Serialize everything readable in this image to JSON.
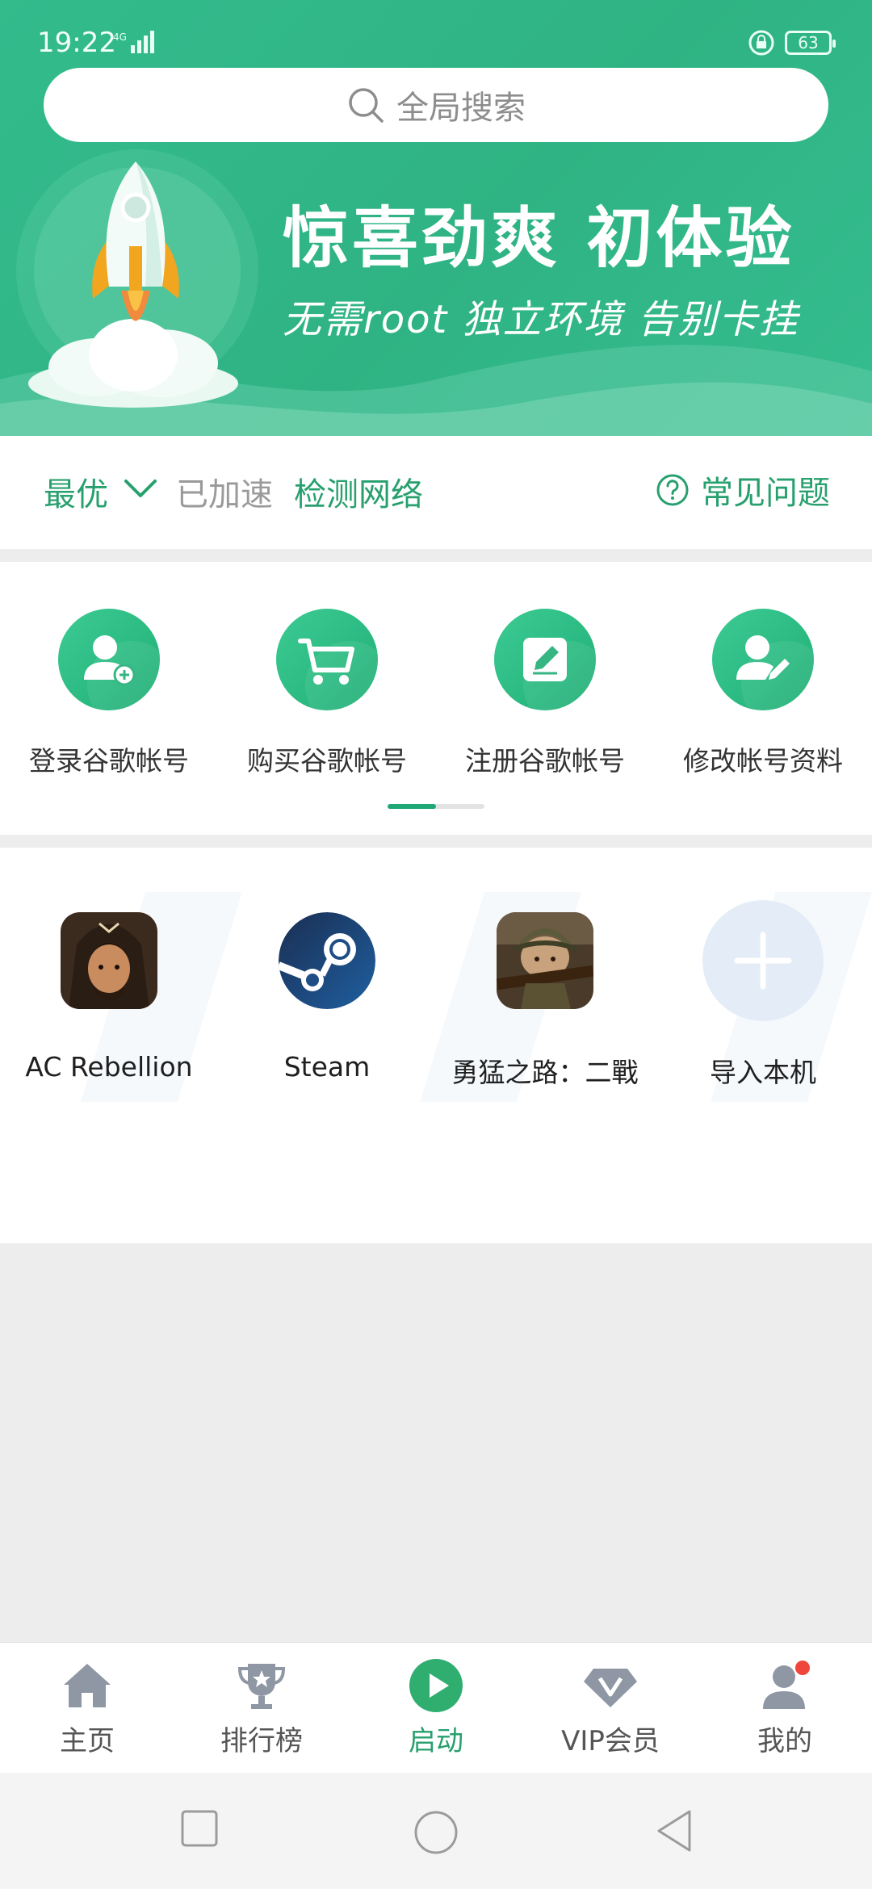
{
  "status_bar": {
    "time": "19:22",
    "network": "4G",
    "battery": "63"
  },
  "search": {
    "placeholder": "全局搜索"
  },
  "banner": {
    "title": "惊喜劲爽  初体验",
    "subtitle": "无需root  独立环境  告别卡挂"
  },
  "network_bar": {
    "mode": "最优",
    "status": "已加速",
    "check_label": "检测网络",
    "faq_label": "常见问题"
  },
  "actions": [
    {
      "label": "登录谷歌帐号",
      "icon": "user-add-icon"
    },
    {
      "label": "购买谷歌帐号",
      "icon": "cart-icon"
    },
    {
      "label": "注册谷歌帐号",
      "icon": "edit-note-icon"
    },
    {
      "label": "修改帐号资料",
      "icon": "user-edit-icon"
    }
  ],
  "pager": {
    "current": 1,
    "total": 2
  },
  "apps": [
    {
      "label": "AC Rebellion",
      "icon": "ac-rebellion-icon"
    },
    {
      "label": "Steam",
      "icon": "steam-icon"
    },
    {
      "label": "勇猛之路：二戰",
      "icon": "soldier-game-icon"
    },
    {
      "label": "导入本机",
      "icon": "plus-icon"
    }
  ],
  "bottom_nav": [
    {
      "label": "主页",
      "icon": "home-icon",
      "active": false
    },
    {
      "label": "排行榜",
      "icon": "trophy-icon",
      "active": false
    },
    {
      "label": "启动",
      "icon": "play-icon",
      "active": true
    },
    {
      "label": "VIP会员",
      "icon": "vip-diamond-icon",
      "active": false
    },
    {
      "label": "我的",
      "icon": "profile-icon",
      "active": false
    }
  ],
  "colors": {
    "brand_green": "#2fb384",
    "accent_text": "#28a06e",
    "badge_red": "#f0453a"
  }
}
